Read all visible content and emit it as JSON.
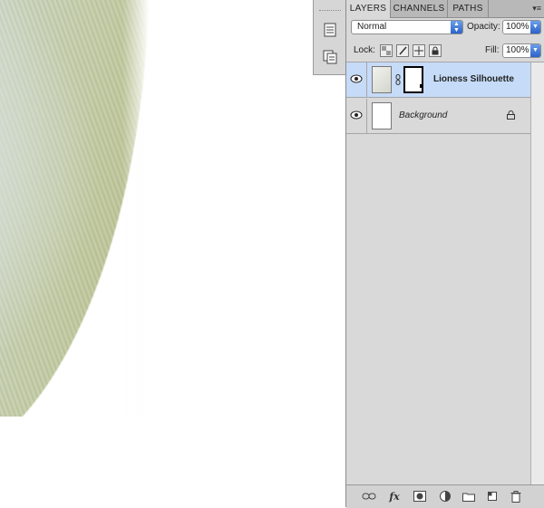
{
  "panel": {
    "tabs": [
      "LAYERS",
      "CHANNELS",
      "PATHS"
    ],
    "active_tab": "LAYERS",
    "menu_icon": "≡"
  },
  "blend": {
    "mode": "Normal",
    "opacity_label": "Opacity:",
    "opacity_value": "100%"
  },
  "lock": {
    "label": "Lock:",
    "fill_label": "Fill:",
    "fill_value": "100%"
  },
  "layers": [
    {
      "name": "Lioness Silhouette",
      "visible": true,
      "selected": true,
      "has_mask": true
    },
    {
      "name": "Background",
      "visible": true,
      "selected": false,
      "locked": true
    }
  ],
  "bottom_bar": {
    "fx_label": "fx"
  },
  "colors": {
    "selection": "#c6dbf7",
    "panel_bg": "#d9d9d9",
    "accent_blue": "#2c62c8"
  }
}
